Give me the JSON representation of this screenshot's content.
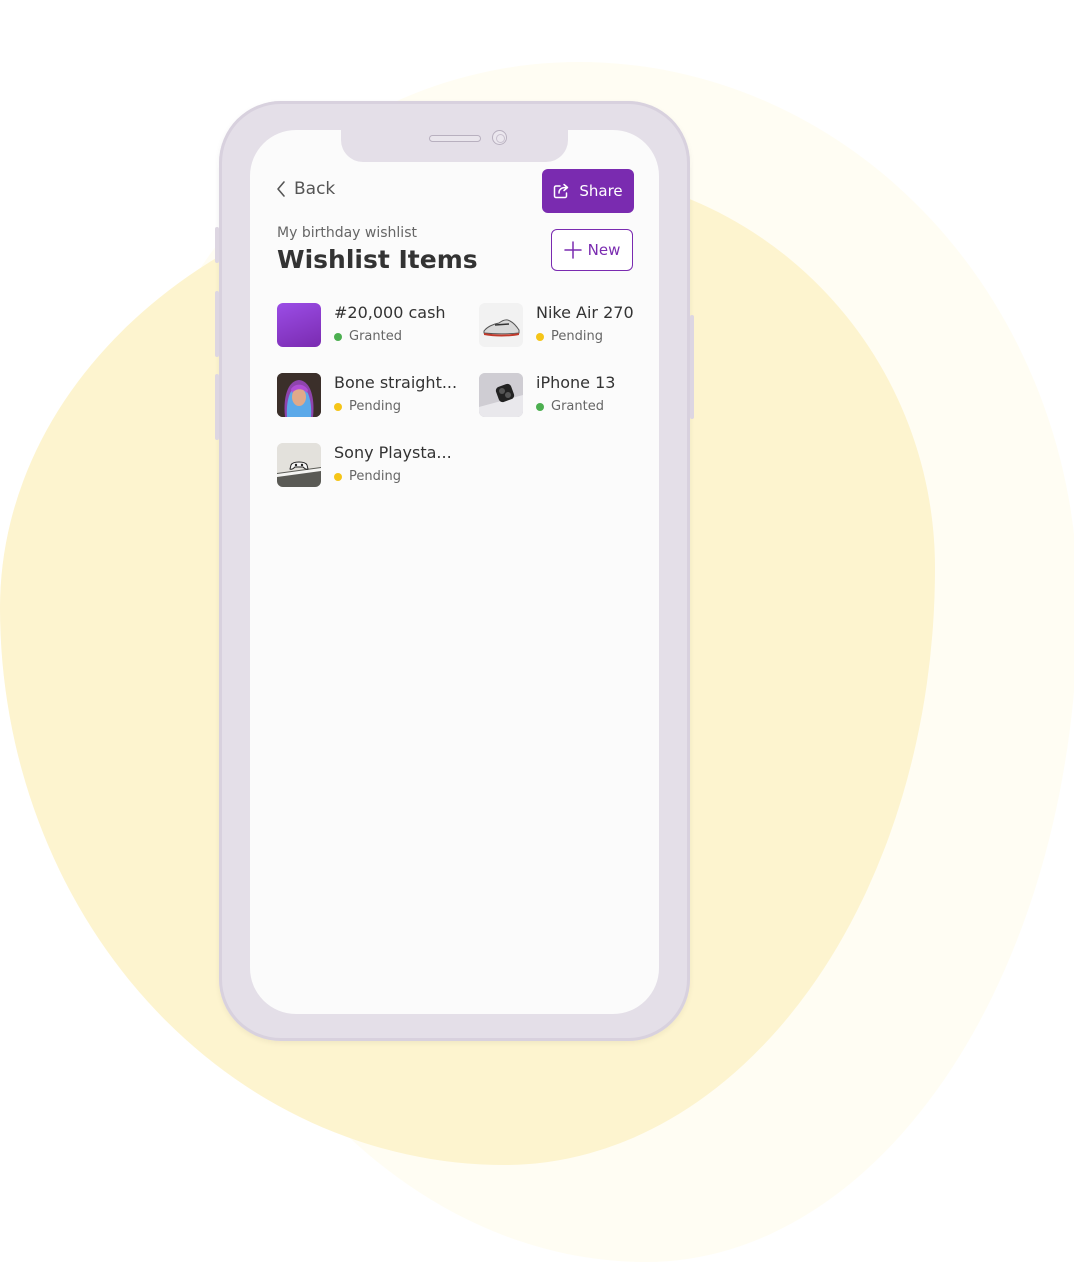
{
  "header": {
    "back_label": "Back",
    "share_label": "Share",
    "new_label": "New",
    "subtitle": "My birthday wishlist",
    "title": "Wishlist Items"
  },
  "colors": {
    "accent": "#7a2bb0",
    "granted": "#4caf50",
    "pending": "#f5c518"
  },
  "items": [
    {
      "name": "#20,000 cash",
      "status": "Granted",
      "status_type": "granted"
    },
    {
      "name": "Nike Air 270",
      "status": "Pending",
      "status_type": "pending"
    },
    {
      "name": "Bone straight...",
      "status": "Pending",
      "status_type": "pending"
    },
    {
      "name": "iPhone 13",
      "status": "Granted",
      "status_type": "granted"
    },
    {
      "name": "Sony Playsta...",
      "status": "Pending",
      "status_type": "pending"
    }
  ]
}
